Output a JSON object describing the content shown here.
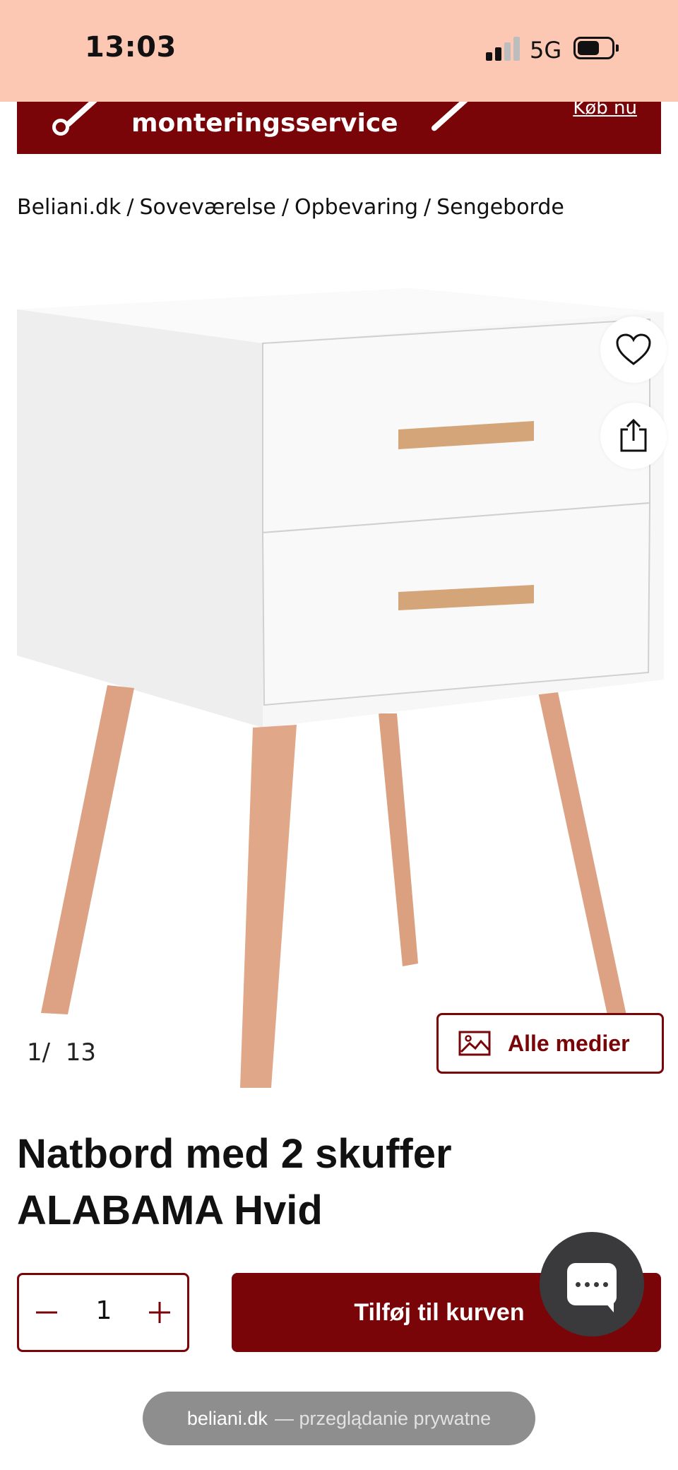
{
  "status_bar": {
    "time": "13:03",
    "network": "5G",
    "battery_level": 0.6
  },
  "promo_banner": {
    "text": "monteringsservice",
    "link": "Køb nu",
    "background_color": "#7a0508"
  },
  "breadcrumb": [
    "Beliani.dk",
    "Soveværelse",
    "Opbevaring",
    "Sengeborde"
  ],
  "gallery": {
    "current": "1",
    "separator": "/",
    "total": "13",
    "all_media_label": "Alle medier",
    "icons": [
      "heart-icon",
      "share-icon",
      "image-icon"
    ]
  },
  "product": {
    "title_line1": "Natbord med 2 skuffer",
    "title_line2": "ALABAMA Hvid"
  },
  "purchase": {
    "quantity": "1",
    "add_to_cart_label": "Tilføj til kurven"
  },
  "chat": {
    "icon": "chat-bubble-icon"
  },
  "browser": {
    "domain": "beliani.dk",
    "mode_text": "— przeglądanie prywatne"
  },
  "colors": {
    "accent": "#7a0508",
    "status_bar": "#fcc8b4"
  }
}
